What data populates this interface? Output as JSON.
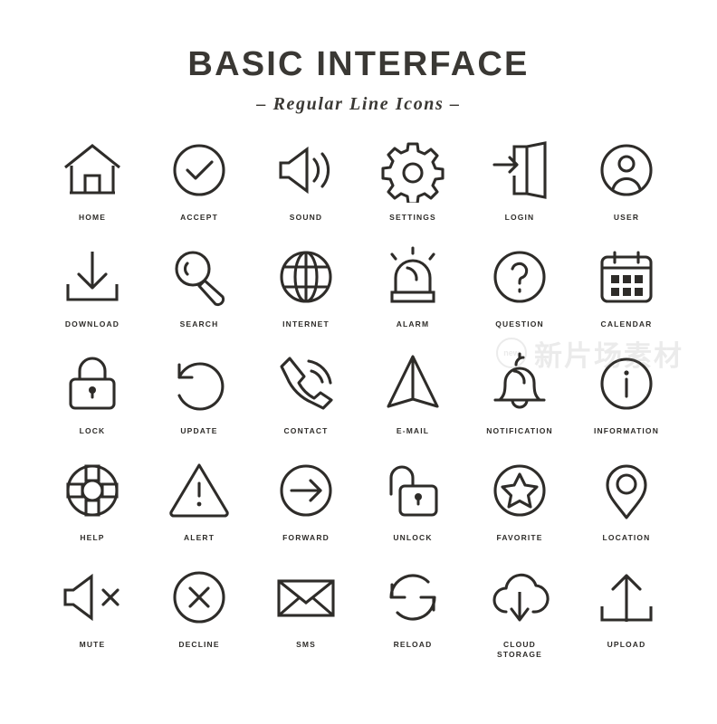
{
  "page": {
    "background_color": "#ffffff",
    "ink_color": "#2e2c29"
  },
  "header": {
    "title": "BASIC INTERFACE",
    "subtitle": "– Regular Line Icons –"
  },
  "watermark": {
    "badge": "new",
    "text": "新片场素材"
  },
  "grid": {
    "columns": 6,
    "rows": 5
  },
  "icons": [
    {
      "label": "HOME",
      "glyph": "home-icon"
    },
    {
      "label": "ACCEPT",
      "glyph": "check-circle-icon"
    },
    {
      "label": "SOUND",
      "glyph": "speaker-waves-icon"
    },
    {
      "label": "SETTINGS",
      "glyph": "gear-icon"
    },
    {
      "label": "LOGIN",
      "glyph": "login-door-icon"
    },
    {
      "label": "USER",
      "glyph": "user-circle-icon"
    },
    {
      "label": "DOWNLOAD",
      "glyph": "download-tray-icon"
    },
    {
      "label": "SEARCH",
      "glyph": "magnifier-icon"
    },
    {
      "label": "INTERNET",
      "glyph": "globe-icon"
    },
    {
      "label": "ALARM",
      "glyph": "siren-icon"
    },
    {
      "label": "QUESTION",
      "glyph": "question-circle-icon"
    },
    {
      "label": "CALENDAR",
      "glyph": "calendar-icon"
    },
    {
      "label": "LOCK",
      "glyph": "padlock-closed-icon"
    },
    {
      "label": "UPDATE",
      "glyph": "circular-arrow-icon"
    },
    {
      "label": "CONTACT",
      "glyph": "phone-handset-icon"
    },
    {
      "label": "E-MAIL",
      "glyph": "paper-plane-icon"
    },
    {
      "label": "NOTIFICATION",
      "glyph": "bell-icon"
    },
    {
      "label": "INFORMATION",
      "glyph": "info-circle-icon"
    },
    {
      "label": "HELP",
      "glyph": "life-ring-icon"
    },
    {
      "label": "ALERT",
      "glyph": "warning-triangle-icon"
    },
    {
      "label": "FORWARD",
      "glyph": "arrow-right-circle-icon"
    },
    {
      "label": "UNLOCK",
      "glyph": "padlock-open-icon"
    },
    {
      "label": "FAVORITE",
      "glyph": "star-circle-icon"
    },
    {
      "label": "LOCATION",
      "glyph": "map-pin-icon"
    },
    {
      "label": "MUTE",
      "glyph": "speaker-mute-icon"
    },
    {
      "label": "DECLINE",
      "glyph": "cross-circle-icon"
    },
    {
      "label": "SMS",
      "glyph": "envelope-icon"
    },
    {
      "label": "RELOAD",
      "glyph": "refresh-arrows-icon"
    },
    {
      "label": "CLOUD\nSTORAGE",
      "glyph": "cloud-download-icon"
    },
    {
      "label": "UPLOAD",
      "glyph": "upload-tray-icon"
    }
  ]
}
